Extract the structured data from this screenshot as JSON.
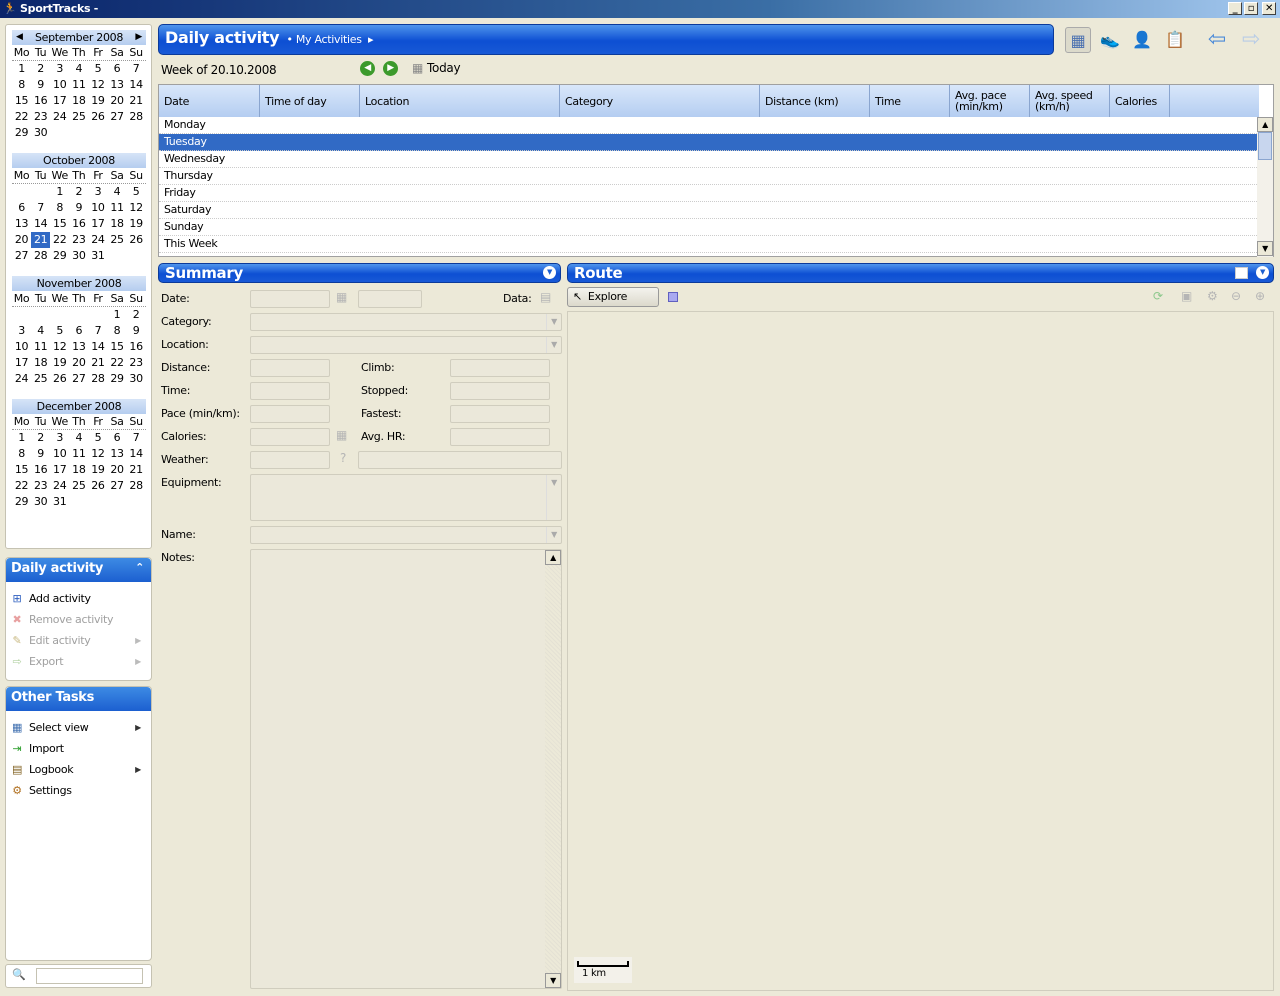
{
  "window": {
    "title": "SportTracks -",
    "min": "_",
    "max": "▫",
    "close": "✕"
  },
  "calendar": {
    "dow": [
      "Mo",
      "Tu",
      "We",
      "Th",
      "Fr",
      "Sa",
      "Su"
    ],
    "selected_month": "October 2008",
    "selected_day": 21,
    "months": [
      {
        "name": "September 2008",
        "weeks": [
          [
            1,
            2,
            3,
            4,
            5,
            6,
            7
          ],
          [
            8,
            9,
            10,
            11,
            12,
            13,
            14
          ],
          [
            15,
            16,
            17,
            18,
            19,
            20,
            21
          ],
          [
            22,
            23,
            24,
            25,
            26,
            27,
            28
          ],
          [
            29,
            30,
            "",
            "",
            "",
            "",
            ""
          ]
        ]
      },
      {
        "name": "October 2008",
        "weeks": [
          [
            "",
            "",
            1,
            2,
            3,
            4,
            5
          ],
          [
            6,
            7,
            8,
            9,
            10,
            11,
            12
          ],
          [
            13,
            14,
            15,
            16,
            17,
            18,
            19
          ],
          [
            20,
            21,
            22,
            23,
            24,
            25,
            26
          ],
          [
            27,
            28,
            29,
            30,
            31,
            "",
            ""
          ]
        ]
      },
      {
        "name": "November 2008",
        "weeks": [
          [
            "",
            "",
            "",
            "",
            "",
            1,
            2
          ],
          [
            3,
            4,
            5,
            6,
            7,
            8,
            9
          ],
          [
            10,
            11,
            12,
            13,
            14,
            15,
            16
          ],
          [
            17,
            18,
            19,
            20,
            21,
            22,
            23
          ],
          [
            24,
            25,
            26,
            27,
            28,
            29,
            30
          ]
        ]
      },
      {
        "name": "December 2008",
        "weeks": [
          [
            1,
            2,
            3,
            4,
            5,
            6,
            7
          ],
          [
            8,
            9,
            10,
            11,
            12,
            13,
            14
          ],
          [
            15,
            16,
            17,
            18,
            19,
            20,
            21
          ],
          [
            22,
            23,
            24,
            25,
            26,
            27,
            28
          ],
          [
            29,
            30,
            31,
            "",
            "",
            "",
            ""
          ]
        ]
      }
    ]
  },
  "tasks_daily": {
    "title": "Daily activity",
    "items": [
      {
        "label": "Add activity",
        "icon": "add-icon",
        "enabled": true
      },
      {
        "label": "Remove activity",
        "icon": "remove-icon",
        "enabled": false
      },
      {
        "label": "Edit activity",
        "icon": "pencil-icon",
        "enabled": false,
        "submenu": true
      },
      {
        "label": "Export",
        "icon": "export-icon",
        "enabled": false,
        "submenu": true
      }
    ]
  },
  "tasks_other": {
    "title": "Other Tasks",
    "items": [
      {
        "label": "Select view",
        "icon": "view-icon",
        "enabled": true,
        "submenu": true
      },
      {
        "label": "Import",
        "icon": "import-icon",
        "enabled": true
      },
      {
        "label": "Logbook",
        "icon": "logbook-icon",
        "enabled": true,
        "submenu": true
      },
      {
        "label": "Settings",
        "icon": "gear-icon",
        "enabled": true
      }
    ]
  },
  "search": {
    "value": ""
  },
  "header": {
    "title": "Daily activity",
    "crumb": "My Activities"
  },
  "week": {
    "label": "Week of 20.10.2008",
    "today": "Today"
  },
  "table": {
    "columns": [
      "Date",
      "Time of day",
      "Location",
      "Category",
      "Distance (km)",
      "Time",
      "Avg. pace (min/km)",
      "Avg. speed (km/h)",
      "Calories"
    ],
    "rows": [
      "Monday",
      "Tuesday",
      "Wednesday",
      "Thursday",
      "Friday",
      "Saturday",
      "Sunday",
      "This Week"
    ],
    "selected": "Tuesday"
  },
  "summary": {
    "title": "Summary",
    "labels": {
      "date": "Date:",
      "data": "Data:",
      "category": "Category:",
      "location": "Location:",
      "distance": "Distance:",
      "climb": "Climb:",
      "time": "Time:",
      "stopped": "Stopped:",
      "pace": "Pace (min/km):",
      "fastest": "Fastest:",
      "calories": "Calories:",
      "avghr": "Avg. HR:",
      "weather": "Weather:",
      "equipment": "Equipment:",
      "name": "Name:",
      "notes": "Notes:"
    }
  },
  "route": {
    "title": "Route",
    "explore": "Explore",
    "scale": "1 km"
  }
}
